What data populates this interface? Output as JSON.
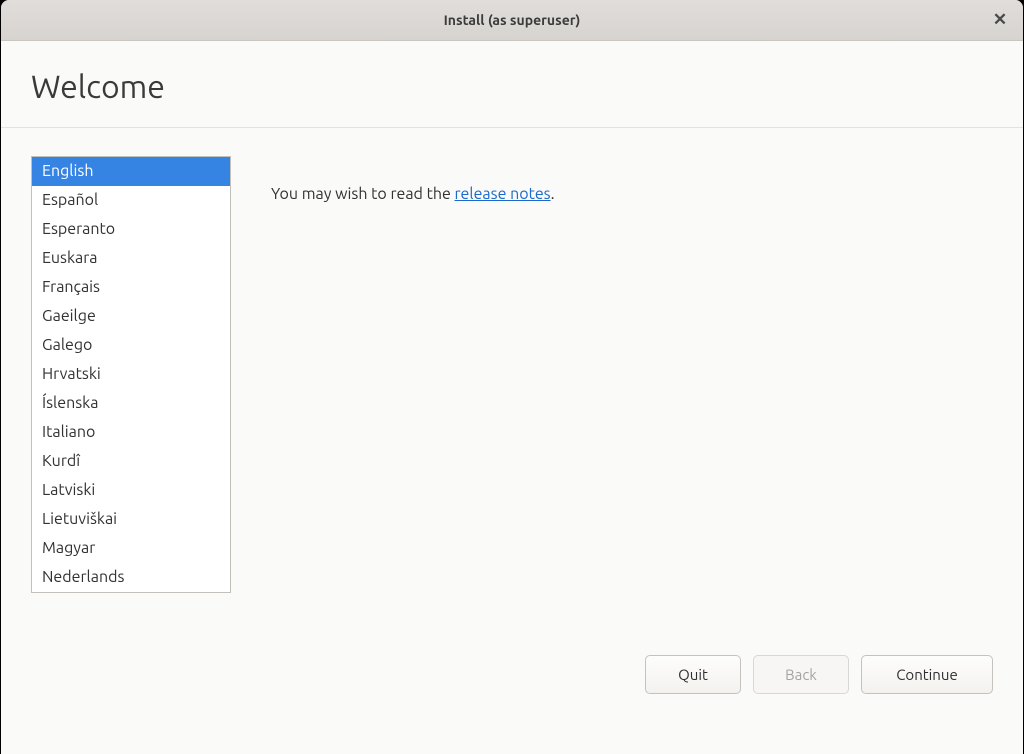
{
  "window": {
    "title": "Install (as superuser)"
  },
  "page": {
    "heading": "Welcome"
  },
  "info": {
    "prefix": "You may wish to read the ",
    "link_text": "release notes",
    "suffix": "."
  },
  "languages": {
    "selected_index": 0,
    "items": [
      "English",
      "Español",
      "Esperanto",
      "Euskara",
      "Français",
      "Gaeilge",
      "Galego",
      "Hrvatski",
      "Íslenska",
      "Italiano",
      "Kurdî",
      "Latviski",
      "Lietuviškai",
      "Magyar",
      "Nederlands"
    ]
  },
  "buttons": {
    "quit": "Quit",
    "back": "Back",
    "continue": "Continue"
  }
}
